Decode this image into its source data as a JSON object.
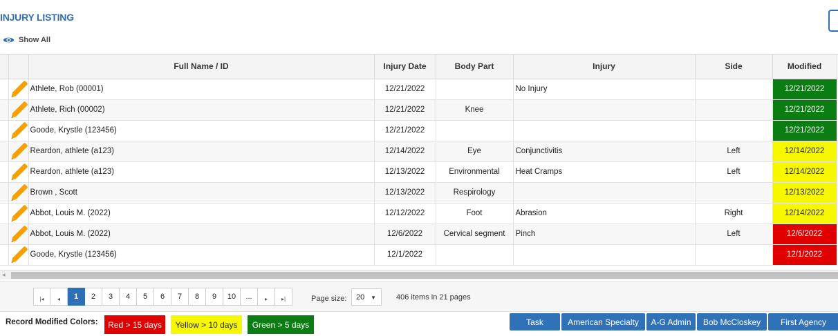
{
  "page": {
    "title": "INJURY LISTING",
    "show_all": "Show All"
  },
  "table": {
    "columns": [
      "",
      "",
      "Full Name / ID",
      "Injury Date",
      "Body Part",
      "Injury",
      "Side",
      "Modified"
    ],
    "rows": [
      {
        "name": "Athlete, Rob (00001)",
        "date": "12/21/2022",
        "body": "",
        "injury": "No Injury",
        "side": "",
        "modified": "12/21/2022",
        "status": "green"
      },
      {
        "name": "Athlete, Rich (00002)",
        "date": "12/21/2022",
        "body": "Knee",
        "injury": "",
        "side": "",
        "modified": "12/21/2022",
        "status": "green"
      },
      {
        "name": "Goode, Krystle (123456)",
        "date": "12/21/2022",
        "body": "",
        "injury": "",
        "side": "",
        "modified": "12/21/2022",
        "status": "green"
      },
      {
        "name": "Reardon, athlete (a123)",
        "date": "12/14/2022",
        "body": "Eye",
        "injury": "Conjunctivitis",
        "side": "Left",
        "modified": "12/14/2022",
        "status": "yellow"
      },
      {
        "name": "Reardon, athlete (a123)",
        "date": "12/13/2022",
        "body": "Environmental",
        "injury": "Heat Cramps",
        "side": "Left",
        "modified": "12/14/2022",
        "status": "yellow"
      },
      {
        "name": "Brown , Scott",
        "date": "12/13/2022",
        "body": "Respirology",
        "injury": "",
        "side": "",
        "modified": "12/13/2022",
        "status": "yellow"
      },
      {
        "name": "Abbot, Louis M. (2022)",
        "date": "12/12/2022",
        "body": "Foot",
        "injury": "Abrasion",
        "side": "Right",
        "modified": "12/14/2022",
        "status": "yellow"
      },
      {
        "name": "Abbot, Louis M. (2022)",
        "date": "12/6/2022",
        "body": "Cervical segment",
        "injury": "Pinch",
        "side": "Left",
        "modified": "12/6/2022",
        "status": "red"
      },
      {
        "name": "Goode, Krystle (123456)",
        "date": "12/1/2022",
        "body": "",
        "injury": "",
        "side": "",
        "modified": "12/1/2022",
        "status": "red"
      }
    ]
  },
  "pager": {
    "pages": [
      "1",
      "2",
      "3",
      "4",
      "5",
      "6",
      "7",
      "8",
      "9",
      "10",
      "..."
    ],
    "current": "1",
    "page_size_label": "Page size:",
    "page_size": "20",
    "items_info": "406  items in  21  pages"
  },
  "legend": {
    "label": "Record Modified Colors:",
    "red": "Red > 15 days",
    "yellow": "Yellow > 10 days",
    "green": "Green > 5 days"
  },
  "agencies": [
    "Task",
    "American Specialty",
    "A-G Admin",
    "Bob McCloskey",
    "First Agency"
  ],
  "icons": {
    "eye": "eye-icon",
    "edit": "pencil-icon"
  },
  "colors": {
    "red": "#e00000",
    "yellow": "#f7f700",
    "green": "#0b7d12",
    "accent": "#2e6fb5"
  }
}
